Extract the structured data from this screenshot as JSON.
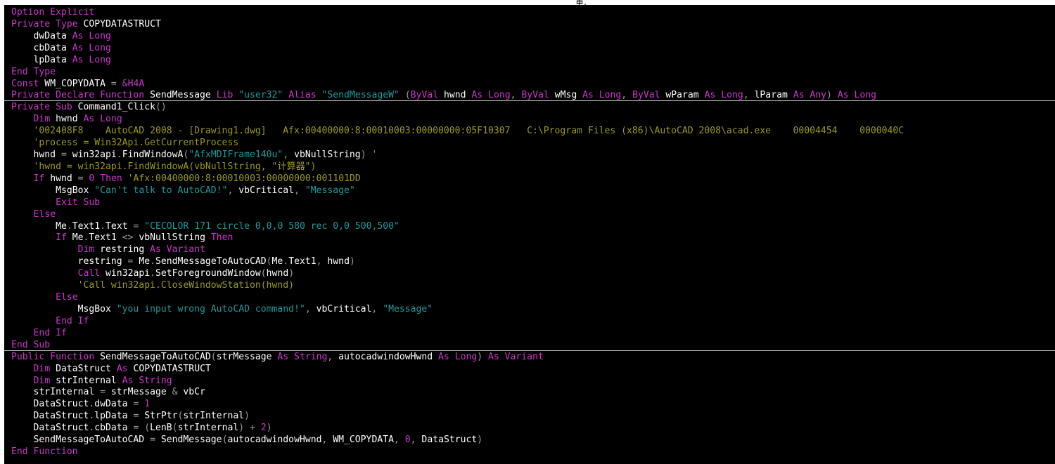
{
  "top_fragment": "重,",
  "colors": {
    "background": "#000000",
    "keyword": "#cc33cc",
    "string": "#1a9a9a",
    "comment": "#9a9a1a",
    "identifier": "#ffffff",
    "operator": "#9a9a9a",
    "separator": "#c0c0c0"
  },
  "code": {
    "lines": [
      [
        [
          "k",
          "Option Explicit"
        ]
      ],
      [
        [
          "k",
          "Private Type"
        ],
        [
          "i",
          " COPYDATASTRUCT"
        ]
      ],
      [
        [
          "i",
          "    dwData "
        ],
        [
          "k",
          "As Long"
        ]
      ],
      [
        [
          "i",
          "    cbData "
        ],
        [
          "k",
          "As Long"
        ]
      ],
      [
        [
          "i",
          "    lpData "
        ],
        [
          "k",
          "As Long"
        ]
      ],
      [
        [
          "k",
          "End Type"
        ]
      ],
      [
        [
          "k",
          "Const"
        ],
        [
          "i",
          " WM_COPYDATA "
        ],
        [
          "o",
          "="
        ],
        [
          "i",
          " "
        ],
        [
          "n",
          "&H4A"
        ]
      ],
      [
        [
          "k",
          "Private Declare Function"
        ],
        [
          "i",
          " SendMessage "
        ],
        [
          "k",
          "Lib"
        ],
        [
          "i",
          " "
        ],
        [
          "s",
          "\"user32\""
        ],
        [
          "i",
          " "
        ],
        [
          "k",
          "Alias"
        ],
        [
          "i",
          " "
        ],
        [
          "s",
          "\"SendMessageW\""
        ],
        [
          "i",
          " "
        ],
        [
          "o",
          "("
        ],
        [
          "k",
          "ByVal"
        ],
        [
          "i",
          " hwnd "
        ],
        [
          "k",
          "As Long"
        ],
        [
          "o",
          ","
        ],
        [
          "i",
          " "
        ],
        [
          "k",
          "ByVal"
        ],
        [
          "i",
          " wMsg "
        ],
        [
          "k",
          "As Long"
        ],
        [
          "o",
          ","
        ],
        [
          "i",
          " "
        ],
        [
          "k",
          "ByVal"
        ],
        [
          "i",
          " wParam "
        ],
        [
          "k",
          "As Long"
        ],
        [
          "o",
          ","
        ],
        [
          "i",
          " lParam "
        ],
        [
          "k",
          "As Any"
        ],
        [
          "o",
          ")"
        ],
        [
          "i",
          " "
        ],
        [
          "k",
          "As Long"
        ]
      ],
      [
        [
          "k",
          "Private Sub"
        ],
        [
          "i",
          " Command1_Click"
        ],
        [
          "o",
          "()"
        ]
      ],
      [
        [
          "i",
          "    "
        ],
        [
          "k",
          "Dim"
        ],
        [
          "i",
          " hwnd "
        ],
        [
          "k",
          "As Long"
        ]
      ],
      [
        [
          "c",
          "    '002408F8    AutoCAD 2008 - [Drawing1.dwg]   Afx:00400000:8:00010003:00000000:05F10307   C:\\Program Files (x86)\\AutoCAD 2008\\acad.exe    00004454    0000040C"
        ]
      ],
      [
        [
          "c",
          "    'process = Win32Api.GetCurrentProcess"
        ]
      ],
      [
        [
          "i",
          "    hwnd "
        ],
        [
          "o",
          "="
        ],
        [
          "i",
          " win32api"
        ],
        [
          "o",
          "."
        ],
        [
          "i",
          "FindWindowA"
        ],
        [
          "o",
          "("
        ],
        [
          "s",
          "\"AfxMDIFrame140u\""
        ],
        [
          "o",
          ","
        ],
        [
          "i",
          " vbNullString"
        ],
        [
          "o",
          ")"
        ],
        [
          "i",
          " "
        ],
        [
          "c",
          "'"
        ]
      ],
      [
        [
          "c",
          "    'hwnd = win32api.FindWindowA(vbNullString, \"计算器\")"
        ]
      ],
      [
        [
          "i",
          "    "
        ],
        [
          "k",
          "If"
        ],
        [
          "i",
          " hwnd "
        ],
        [
          "o",
          "="
        ],
        [
          "i",
          " "
        ],
        [
          "n",
          "0"
        ],
        [
          "i",
          " "
        ],
        [
          "k",
          "Then"
        ],
        [
          "i",
          " "
        ],
        [
          "c",
          "'Afx:00400000:8:00010003:00000000:001101DD"
        ]
      ],
      [
        [
          "i",
          "        MsgBox "
        ],
        [
          "s",
          "\"Can't talk to AutoCAD!\""
        ],
        [
          "o",
          ","
        ],
        [
          "i",
          " vbCritical"
        ],
        [
          "o",
          ","
        ],
        [
          "i",
          " "
        ],
        [
          "s",
          "\"Message\""
        ]
      ],
      [
        [
          "i",
          "        "
        ],
        [
          "k",
          "Exit Sub"
        ]
      ],
      [
        [
          "i",
          "    "
        ],
        [
          "k",
          "Else"
        ]
      ],
      [
        [
          "i",
          "        Me"
        ],
        [
          "o",
          "."
        ],
        [
          "i",
          "Text1"
        ],
        [
          "o",
          "."
        ],
        [
          "i",
          "Text "
        ],
        [
          "o",
          "="
        ],
        [
          "i",
          " "
        ],
        [
          "s",
          "\"CECOLOR 171 circle 0,0,0 580 rec 0,0 500,500\""
        ]
      ],
      [
        [
          "i",
          "        "
        ],
        [
          "k",
          "If"
        ],
        [
          "i",
          " Me"
        ],
        [
          "o",
          "."
        ],
        [
          "i",
          "Text1 "
        ],
        [
          "o",
          "<>"
        ],
        [
          "i",
          " vbNullString "
        ],
        [
          "k",
          "Then"
        ]
      ],
      [
        [
          "i",
          "            "
        ],
        [
          "k",
          "Dim"
        ],
        [
          "i",
          " restring "
        ],
        [
          "k",
          "As Variant"
        ]
      ],
      [
        [
          "i",
          "            restring "
        ],
        [
          "o",
          "="
        ],
        [
          "i",
          " Me"
        ],
        [
          "o",
          "."
        ],
        [
          "i",
          "SendMessageToAutoCAD"
        ],
        [
          "o",
          "("
        ],
        [
          "i",
          "Me"
        ],
        [
          "o",
          "."
        ],
        [
          "i",
          "Text1"
        ],
        [
          "o",
          ","
        ],
        [
          "i",
          " hwnd"
        ],
        [
          "o",
          ")"
        ]
      ],
      [
        [
          "i",
          "            "
        ],
        [
          "k",
          "Call"
        ],
        [
          "i",
          " win32api"
        ],
        [
          "o",
          "."
        ],
        [
          "i",
          "SetForegroundWindow"
        ],
        [
          "o",
          "("
        ],
        [
          "i",
          "hwnd"
        ],
        [
          "o",
          ")"
        ]
      ],
      [
        [
          "c",
          "            'Call win32api.CloseWindowStation(hwnd)"
        ]
      ],
      [
        [
          "i",
          "        "
        ],
        [
          "k",
          "Else"
        ]
      ],
      [
        [
          "i",
          "            MsgBox "
        ],
        [
          "s",
          "\"you input wrong AutoCAD command!\""
        ],
        [
          "o",
          ","
        ],
        [
          "i",
          " vbCritical"
        ],
        [
          "o",
          ","
        ],
        [
          "i",
          " "
        ],
        [
          "s",
          "\"Message\""
        ]
      ],
      [
        [
          "i",
          "        "
        ],
        [
          "k",
          "End If"
        ]
      ],
      [
        [
          "i",
          "    "
        ],
        [
          "k",
          "End If"
        ]
      ],
      [
        [
          "k",
          "End Sub"
        ]
      ],
      [
        [
          "k",
          "Public Function"
        ],
        [
          "i",
          " SendMessageToAutoCAD"
        ],
        [
          "o",
          "("
        ],
        [
          "i",
          "strMessage "
        ],
        [
          "k",
          "As String"
        ],
        [
          "o",
          ","
        ],
        [
          "i",
          " autocadwindowHwnd "
        ],
        [
          "k",
          "As Long"
        ],
        [
          "o",
          ")"
        ],
        [
          "i",
          " "
        ],
        [
          "k",
          "As Variant"
        ]
      ],
      [
        [
          "i",
          "    "
        ],
        [
          "k",
          "Dim"
        ],
        [
          "i",
          " DataStruct "
        ],
        [
          "k",
          "As"
        ],
        [
          "i",
          " COPYDATASTRUCT"
        ]
      ],
      [
        [
          "i",
          "    "
        ],
        [
          "k",
          "Dim"
        ],
        [
          "i",
          " strInternal "
        ],
        [
          "k",
          "As String"
        ]
      ],
      [
        [
          "i",
          "    strInternal "
        ],
        [
          "o",
          "="
        ],
        [
          "i",
          " strMessage "
        ],
        [
          "o",
          "&"
        ],
        [
          "i",
          " vbCr"
        ]
      ],
      [
        [
          "i",
          "    DataStruct"
        ],
        [
          "o",
          "."
        ],
        [
          "i",
          "dwData "
        ],
        [
          "o",
          "="
        ],
        [
          "i",
          " "
        ],
        [
          "n",
          "1"
        ]
      ],
      [
        [
          "i",
          "    DataStruct"
        ],
        [
          "o",
          "."
        ],
        [
          "i",
          "lpData "
        ],
        [
          "o",
          "="
        ],
        [
          "i",
          " StrPtr"
        ],
        [
          "o",
          "("
        ],
        [
          "i",
          "strInternal"
        ],
        [
          "o",
          ")"
        ]
      ],
      [
        [
          "i",
          "    DataStruct"
        ],
        [
          "o",
          "."
        ],
        [
          "i",
          "cbData "
        ],
        [
          "o",
          "="
        ],
        [
          "i",
          " "
        ],
        [
          "o",
          "("
        ],
        [
          "i",
          "LenB"
        ],
        [
          "o",
          "("
        ],
        [
          "i",
          "strInternal"
        ],
        [
          "o",
          ")"
        ],
        [
          "i",
          " "
        ],
        [
          "o",
          "+"
        ],
        [
          "i",
          " "
        ],
        [
          "n",
          "2"
        ],
        [
          "o",
          ")"
        ]
      ],
      [
        [
          "i",
          "    SendMessageToAutoCAD "
        ],
        [
          "o",
          "="
        ],
        [
          "i",
          " SendMessage"
        ],
        [
          "o",
          "("
        ],
        [
          "i",
          "autocadwindowHwnd"
        ],
        [
          "o",
          ","
        ],
        [
          "i",
          " WM_COPYDATA"
        ],
        [
          "o",
          ","
        ],
        [
          "i",
          " "
        ],
        [
          "n",
          "0"
        ],
        [
          "o",
          ","
        ],
        [
          "i",
          " DataStruct"
        ],
        [
          "o",
          ")"
        ]
      ],
      [
        [
          "k",
          "End Function"
        ]
      ]
    ],
    "separators_after_line": [
      7,
      28
    ]
  }
}
